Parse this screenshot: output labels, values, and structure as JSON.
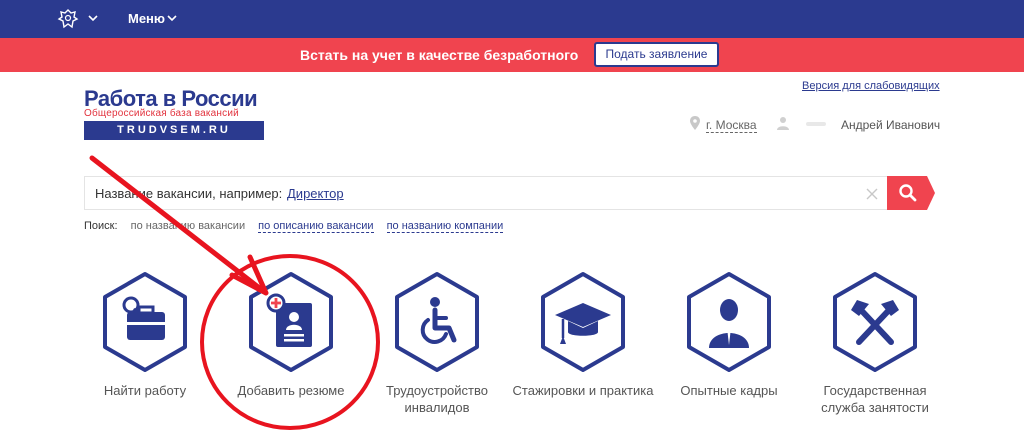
{
  "topbar": {
    "menu_label": "Меню"
  },
  "banner": {
    "text": "Встать на учет в качестве безработного",
    "button": "Подать заявление"
  },
  "logo": {
    "title": "Работа в России",
    "subtitle": "Общероссийская база вакансий",
    "domain": "TRUDVSEM.RU"
  },
  "header": {
    "accessibility_link": "Версия для слабовидящих",
    "city": "г. Москва",
    "user_name": "Андрей Иванович"
  },
  "search": {
    "placeholder": "Название вакансии, например:",
    "example": "Директор",
    "modes_label": "Поиск:",
    "mode_title": "по названию вакансии",
    "mode_description": "по описанию вакансии",
    "mode_company": "по названию компании"
  },
  "tiles": [
    {
      "label": "Найти работу",
      "icon": "briefcase-search-icon"
    },
    {
      "label": "Добавить резюме",
      "icon": "add-resume-icon"
    },
    {
      "label": "Трудоустройство инвалидов",
      "icon": "wheelchair-icon"
    },
    {
      "label": "Стажировки и практика",
      "icon": "graduation-cap-icon"
    },
    {
      "label": "Опытные кадры",
      "icon": "business-person-icon"
    },
    {
      "label": "Государственная служба занятости",
      "icon": "hammers-icon"
    }
  ],
  "colors": {
    "navy": "#2b3a8f",
    "red": "#f0444f",
    "annotation": "#e8141f"
  }
}
